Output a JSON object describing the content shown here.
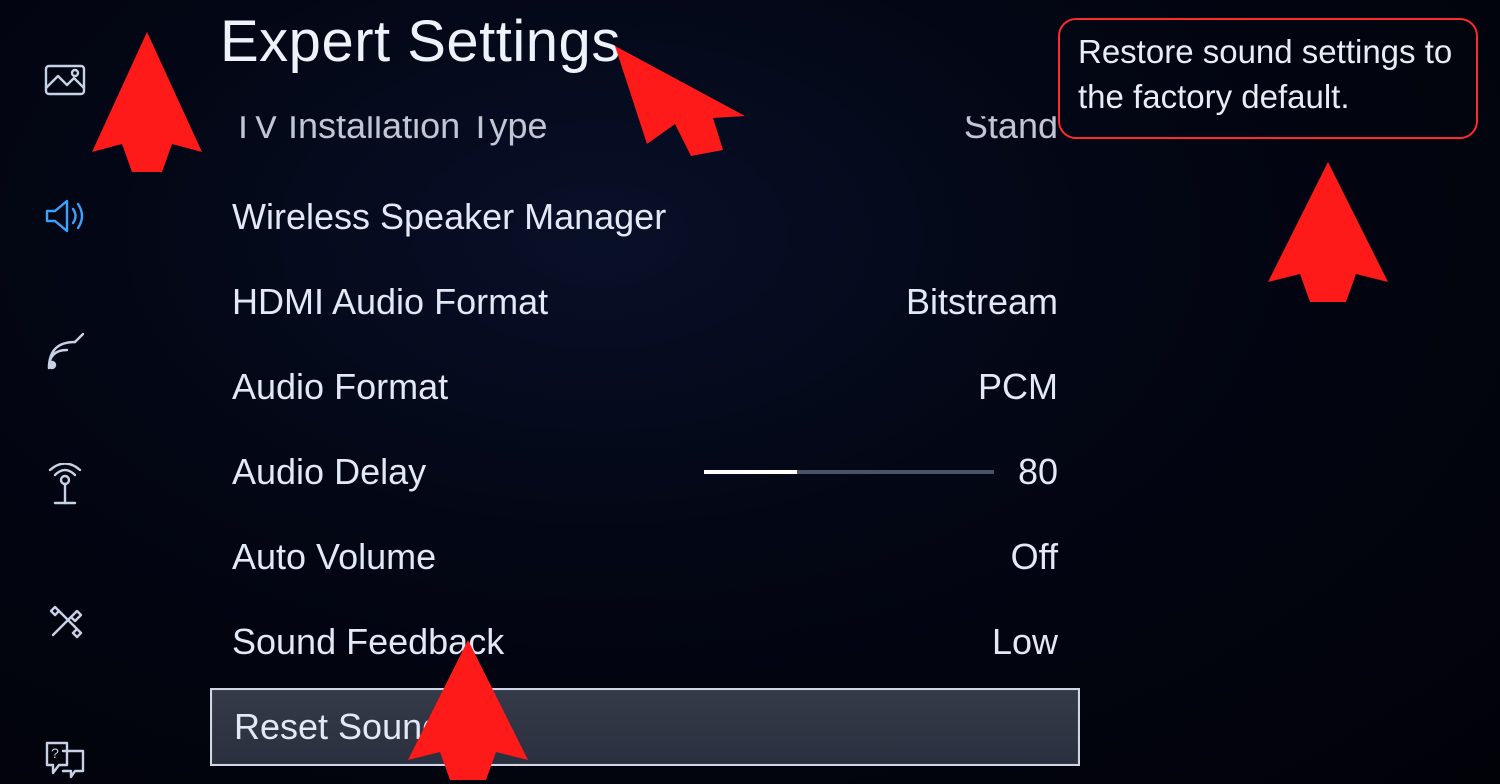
{
  "title": "Expert Settings",
  "sidebar": {
    "items": [
      {
        "name": "picture-icon"
      },
      {
        "name": "sound-icon"
      },
      {
        "name": "broadcast-icon"
      },
      {
        "name": "network-icon"
      },
      {
        "name": "system-icon"
      },
      {
        "name": "support-icon"
      }
    ],
    "active_index": 1
  },
  "rows": [
    {
      "label": "TV Installation Type",
      "value": "Stand"
    },
    {
      "label": "Wireless Speaker Manager",
      "value": ""
    },
    {
      "label": "HDMI Audio Format",
      "value": "Bitstream"
    },
    {
      "label": "Audio Format",
      "value": "PCM"
    },
    {
      "label": "Audio Delay",
      "value": "80",
      "slider_pct": 32
    },
    {
      "label": "Auto Volume",
      "value": "Off"
    },
    {
      "label": "Sound Feedback",
      "value": "Low"
    },
    {
      "label": "Reset Sound",
      "value": "",
      "selected": true
    }
  ],
  "description": "Restore sound settings to the factory default.",
  "colors": {
    "accent_blue": "#3aa3ff",
    "annotation_red": "#ff1a1a"
  }
}
